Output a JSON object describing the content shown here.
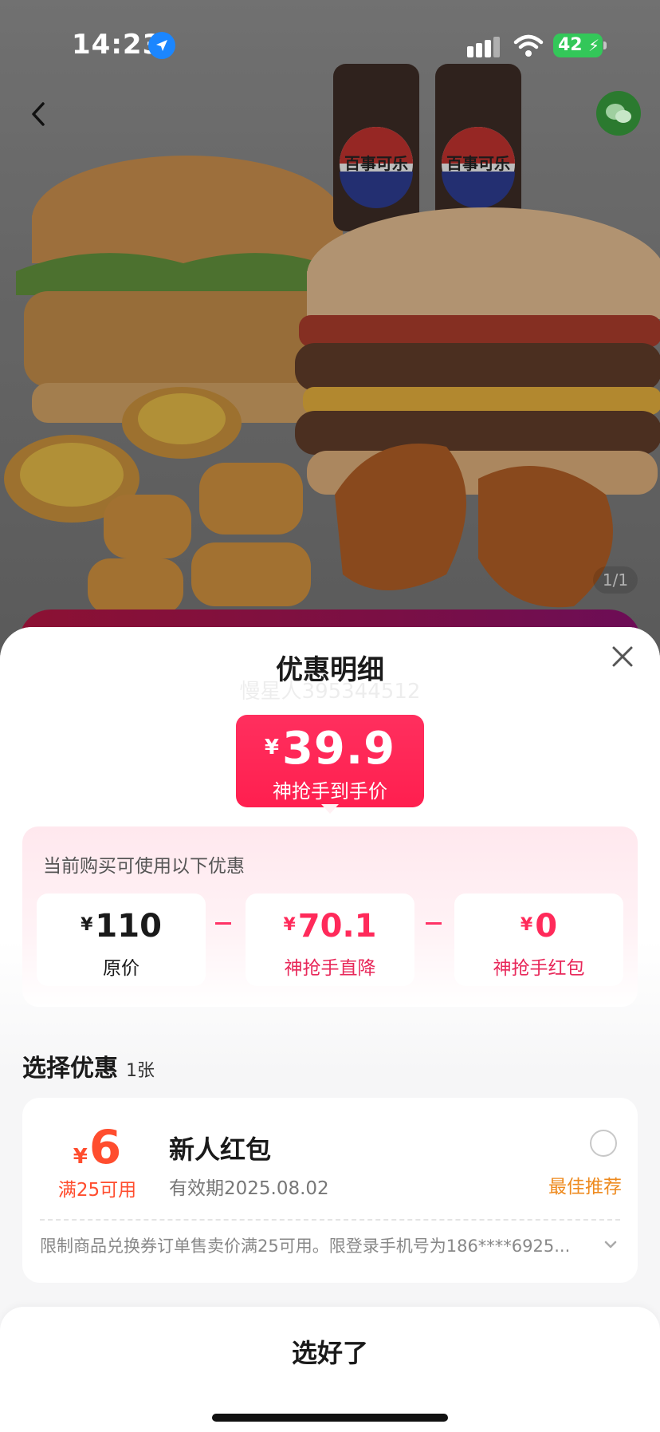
{
  "status_bar": {
    "time": "14:23",
    "battery": "42"
  },
  "hero": {
    "image_counter": "1/1",
    "can_labels": [
      "百事可乐",
      "百事可乐"
    ]
  },
  "sheet": {
    "title": "优惠明细",
    "watermark": "慢星人395344512",
    "final_price": {
      "currency": "¥",
      "amount": "39.9",
      "caption": "神抢手到手价"
    },
    "calc": {
      "label": "当前购买可使用以下优惠",
      "items": [
        {
          "currency": "¥",
          "value": "110",
          "label": "原价"
        },
        {
          "currency": "¥",
          "value": "70.1",
          "label": "神抢手直降"
        },
        {
          "currency": "¥",
          "value": "0",
          "label": "神抢手红包"
        }
      ],
      "operator": "-"
    },
    "section": {
      "title": "选择优惠",
      "count": "1张"
    },
    "coupon": {
      "currency": "¥",
      "value": "6",
      "condition": "满25可用",
      "name": "新人红包",
      "expiry": "有效期2025.08.02",
      "badge": "最佳推荐",
      "note": "限制商品兑换券订单售卖价满25可用。限登录手机号为186****6925..."
    },
    "confirm_label": "选好了"
  },
  "colors": {
    "accent_red": "#ff1f4f",
    "coupon_orange": "#ff4d2e",
    "badge_orange": "#ee8a1e"
  }
}
